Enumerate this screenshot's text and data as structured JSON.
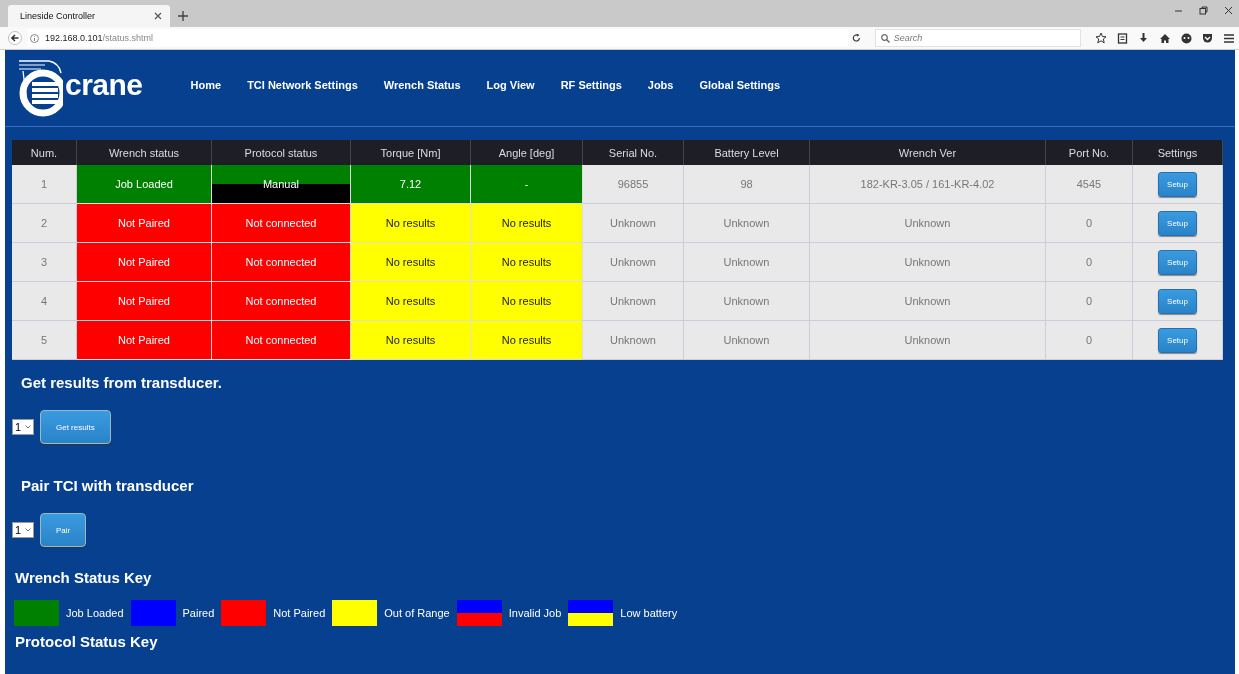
{
  "browser": {
    "tab_title": "Lineside Controller",
    "url_host": "192.168.0.101",
    "url_path": "/status.shtml",
    "search_placeholder": "Search"
  },
  "header": {
    "logo_text": "crane",
    "nav": [
      {
        "label": "Home"
      },
      {
        "label": "TCI Network Settings"
      },
      {
        "label": "Wrench Status"
      },
      {
        "label": "Log View"
      },
      {
        "label": "RF Settings"
      },
      {
        "label": "Jobs"
      },
      {
        "label": "Global Settings"
      }
    ]
  },
  "table": {
    "columns": [
      "Num.",
      "Wrench status",
      "Protocol status",
      "Torque [Nm]",
      "Angle [deg]",
      "Serial No.",
      "Battery Level",
      "Wrench Ver",
      "Port No.",
      "Settings"
    ],
    "rows": [
      {
        "num": "1",
        "wrench_status": {
          "text": "Job Loaded",
          "bands": [
            {
              "color": "#008000"
            }
          ]
        },
        "protocol_status": {
          "text": "Manual",
          "bands": [
            {
              "color": "#008000"
            },
            {
              "color": "#000000"
            }
          ]
        },
        "torque": {
          "text": "7.12",
          "bands": [
            {
              "color": "#008000"
            }
          ]
        },
        "angle": {
          "text": "-",
          "bands": [
            {
              "color": "#008000"
            }
          ]
        },
        "serial": "96855",
        "battery": "98",
        "version": "182-KR-3.05 / 161-KR-4.02",
        "port": "4545",
        "button": "Setup"
      },
      {
        "num": "2",
        "wrench_status": {
          "text": "Not Paired",
          "bands": [
            {
              "color": "#ff0000"
            }
          ]
        },
        "protocol_status": {
          "text": "Not connected",
          "bands": [
            {
              "color": "#ff0000"
            }
          ]
        },
        "torque": {
          "text": "No results",
          "bands": [
            {
              "color": "#ffff00"
            }
          ]
        },
        "angle": {
          "text": "No results",
          "bands": [
            {
              "color": "#ffff00"
            }
          ]
        },
        "serial": "Unknown",
        "battery": "Unknown",
        "version": "Unknown",
        "port": "0",
        "button": "Setup"
      },
      {
        "num": "3",
        "wrench_status": {
          "text": "Not Paired",
          "bands": [
            {
              "color": "#ff0000"
            }
          ]
        },
        "protocol_status": {
          "text": "Not connected",
          "bands": [
            {
              "color": "#ff0000"
            }
          ]
        },
        "torque": {
          "text": "No results",
          "bands": [
            {
              "color": "#ffff00"
            }
          ]
        },
        "angle": {
          "text": "No results",
          "bands": [
            {
              "color": "#ffff00"
            }
          ]
        },
        "serial": "Unknown",
        "battery": "Unknown",
        "version": "Unknown",
        "port": "0",
        "button": "Setup"
      },
      {
        "num": "4",
        "wrench_status": {
          "text": "Not Paired",
          "bands": [
            {
              "color": "#ff0000"
            }
          ]
        },
        "protocol_status": {
          "text": "Not connected",
          "bands": [
            {
              "color": "#ff0000"
            }
          ]
        },
        "torque": {
          "text": "No results",
          "bands": [
            {
              "color": "#ffff00"
            }
          ]
        },
        "angle": {
          "text": "No results",
          "bands": [
            {
              "color": "#ffff00"
            }
          ]
        },
        "serial": "Unknown",
        "battery": "Unknown",
        "version": "Unknown",
        "port": "0",
        "button": "Setup"
      },
      {
        "num": "5",
        "wrench_status": {
          "text": "Not Paired",
          "bands": [
            {
              "color": "#ff0000"
            }
          ]
        },
        "protocol_status": {
          "text": "Not connected",
          "bands": [
            {
              "color": "#ff0000"
            }
          ]
        },
        "torque": {
          "text": "No results",
          "bands": [
            {
              "color": "#ffff00"
            }
          ]
        },
        "angle": {
          "text": "No results",
          "bands": [
            {
              "color": "#ffff00"
            }
          ]
        },
        "serial": "Unknown",
        "battery": "Unknown",
        "version": "Unknown",
        "port": "0",
        "button": "Setup"
      }
    ]
  },
  "actions": [
    {
      "heading": "Get results from transducer.",
      "select_value": "1",
      "button": "Get results"
    },
    {
      "heading": "Pair TCI with transducer",
      "select_value": "1",
      "button": "Pair"
    }
  ],
  "wrench_status_key": {
    "heading": "Wrench Status Key",
    "items": [
      {
        "label": "Job Loaded",
        "bands": [
          {
            "color": "#008000"
          }
        ]
      },
      {
        "label": "Paired",
        "bands": [
          {
            "color": "#0000ff"
          }
        ]
      },
      {
        "label": "Not Paired",
        "bands": [
          {
            "color": "#ff0000"
          }
        ]
      },
      {
        "label": "Out of Range",
        "bands": [
          {
            "color": "#ffff00"
          }
        ]
      },
      {
        "label": "Invalid Job",
        "bands": [
          {
            "color": "#0000ff"
          },
          {
            "color": "#ff0000"
          }
        ]
      },
      {
        "label": "Low battery",
        "bands": [
          {
            "color": "#0000ff"
          },
          {
            "color": "#ffff00"
          }
        ]
      }
    ]
  },
  "protocol_status_key": {
    "heading": "Protocol Status Key"
  }
}
